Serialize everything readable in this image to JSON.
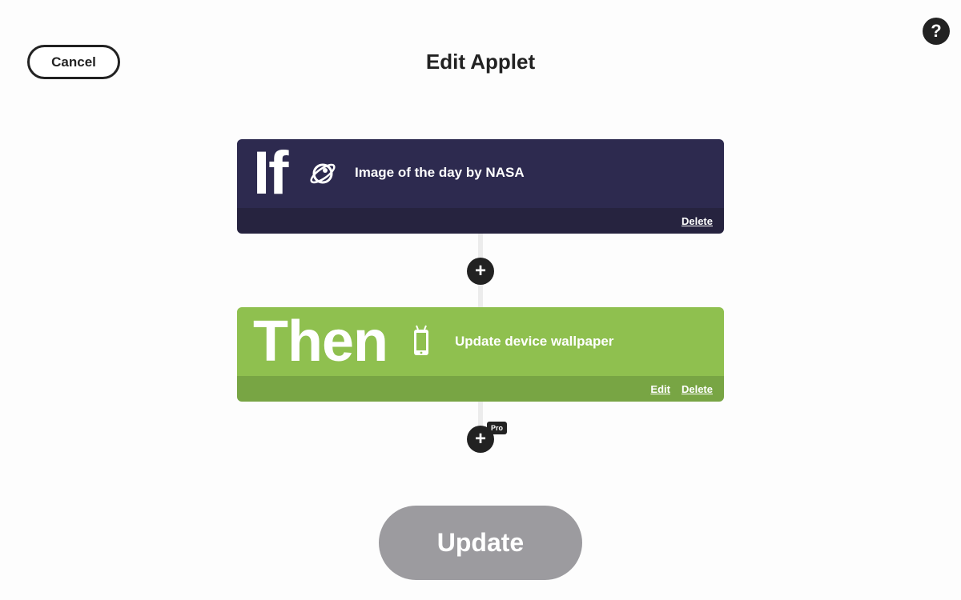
{
  "header": {
    "cancel_label": "Cancel",
    "title": "Edit Applet",
    "help_label": "?"
  },
  "trigger": {
    "keyword": "If",
    "service_icon": "rocket-planet-icon",
    "text": "Image of the day by NASA",
    "delete_label": "Delete",
    "bg_color": "#2d2a4f"
  },
  "action": {
    "keyword": "Then",
    "service_icon": "android-phone-icon",
    "text": "Update device wallpaper",
    "edit_label": "Edit",
    "delete_label": "Delete",
    "bg_color": "#8fc04f"
  },
  "add_step": {
    "plus_label": "+",
    "pro_badge": "Pro"
  },
  "footer": {
    "update_label": "Update",
    "update_color": "#9c9b9f"
  }
}
